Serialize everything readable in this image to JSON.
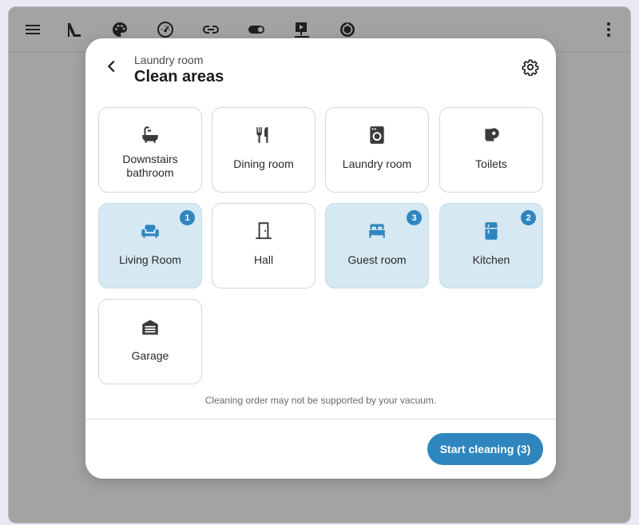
{
  "toolbar": {
    "icons": [
      "menu-icon",
      "slide-icon",
      "palette-icon",
      "gauge-icon",
      "link-icon",
      "toggle-icon",
      "presentation-icon",
      "robot-vacuum-icon",
      "more-vert-icon"
    ]
  },
  "dialog": {
    "subtitle": "Laundry room",
    "title": "Clean areas",
    "areas": [
      {
        "label": "Downstairs bathroom",
        "icon": "bathtub-icon",
        "selected": false,
        "order": null
      },
      {
        "label": "Dining room",
        "icon": "silverware-icon",
        "selected": false,
        "order": null
      },
      {
        "label": "Laundry room",
        "icon": "washing-machine-icon",
        "selected": false,
        "order": null
      },
      {
        "label": "Toilets",
        "icon": "toilet-paper-icon",
        "selected": false,
        "order": null
      },
      {
        "label": "Living Room",
        "icon": "sofa-icon",
        "selected": true,
        "order": "1"
      },
      {
        "label": "Hall",
        "icon": "door-icon",
        "selected": false,
        "order": null
      },
      {
        "label": "Guest room",
        "icon": "bed-icon",
        "selected": true,
        "order": "3"
      },
      {
        "label": "Kitchen",
        "icon": "fridge-icon",
        "selected": true,
        "order": "2"
      },
      {
        "label": "Garage",
        "icon": "garage-icon",
        "selected": false,
        "order": null
      }
    ],
    "note": "Cleaning order may not be supported by your vacuum.",
    "start_label": "Start cleaning (3)"
  },
  "colors": {
    "accent": "#2f86bf",
    "selected_tile": "#d6e8f2",
    "backdrop": "#a3a3a3"
  }
}
